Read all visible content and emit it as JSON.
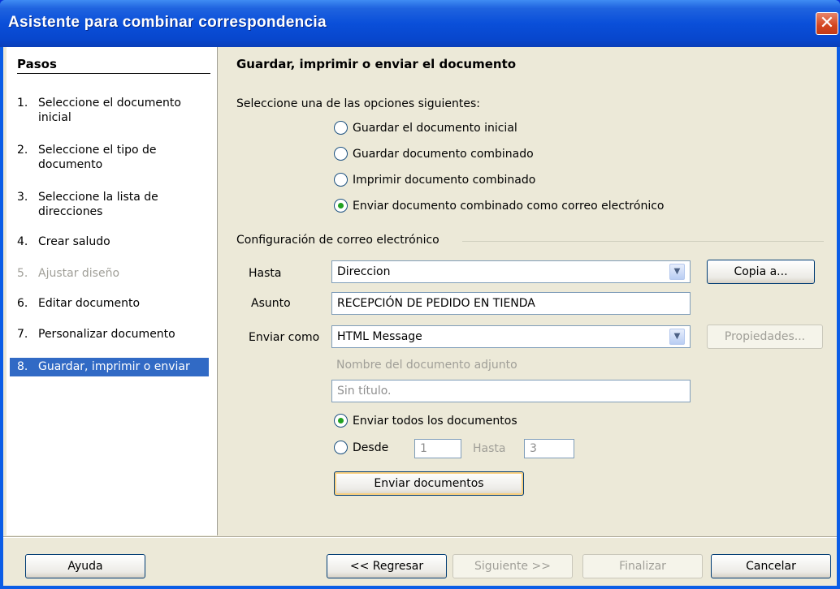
{
  "window": {
    "title": "Asistente para combinar correspondencia",
    "close_glyph": "✕"
  },
  "steps": {
    "heading": "Pasos",
    "items": [
      {
        "num": "1.",
        "label": "Seleccione el documento inicial"
      },
      {
        "num": "2.",
        "label": "Seleccione el tipo de documento"
      },
      {
        "num": "3.",
        "label": "Seleccione la lista de direcciones"
      },
      {
        "num": "4.",
        "label": "Crear saludo"
      },
      {
        "num": "5.",
        "label": "Ajustar diseño"
      },
      {
        "num": "6.",
        "label": "Editar documento"
      },
      {
        "num": "7.",
        "label": "Personalizar documento"
      },
      {
        "num": "8.",
        "label": "Guardar, imprimir o enviar"
      }
    ]
  },
  "main": {
    "heading": "Guardar, imprimir o enviar el documento",
    "prompt": "Seleccione una de las opciones siguientes:",
    "options": [
      {
        "label": "Guardar el documento inicial",
        "selected": false
      },
      {
        "label": "Guardar documento combinado",
        "selected": false
      },
      {
        "label": "Imprimir documento combinado",
        "selected": false
      },
      {
        "label": "Enviar documento combinado como correo electrónico",
        "selected": true
      }
    ]
  },
  "email": {
    "section_title": "Configuración de correo electrónico",
    "to_label": "Hasta",
    "to_value": "Direccion",
    "copy_button": "Copia a...",
    "subject_label": "Asunto",
    "subject_value": "RECEPCIÓN DE PEDIDO EN TIENDA",
    "send_as_label": "Enviar como",
    "send_as_value": "HTML Message",
    "properties_button": "Propiedades...",
    "attachment_label": "Nombre del documento adjunto",
    "attachment_value": "Sin título.",
    "send_all_label": "Enviar todos los documentos",
    "from_label": "Desde",
    "from_value": "1",
    "until_label": "Hasta",
    "until_value": "3",
    "send_button": "Enviar documentos"
  },
  "footer": {
    "help": "Ayuda",
    "back": "<< Regresar",
    "next": "Siguiente >>",
    "finish": "Finalizar",
    "cancel": "Cancelar"
  }
}
